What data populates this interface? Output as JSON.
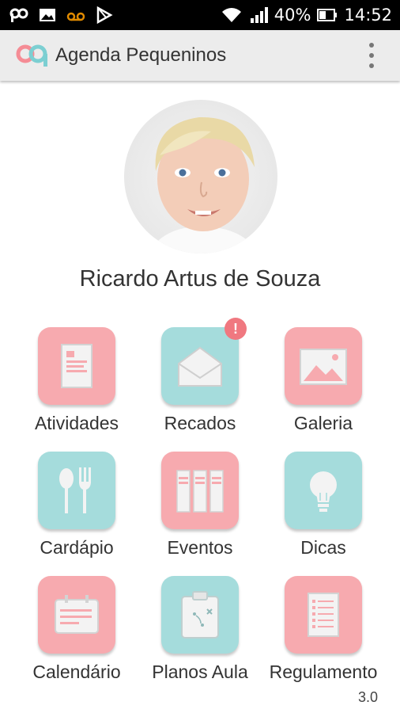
{
  "status_bar": {
    "battery_percent": "40%",
    "time": "14:52"
  },
  "app_bar": {
    "title": "Agenda Pequeninos"
  },
  "profile": {
    "name": "Ricardo Artus de Souza"
  },
  "menu": [
    {
      "label": "Atividades",
      "icon": "document-icon",
      "color": "#f7aaaf"
    },
    {
      "label": "Recados",
      "icon": "envelope-icon",
      "color": "#a5dcdc",
      "badge": "!"
    },
    {
      "label": "Galeria",
      "icon": "image-icon",
      "color": "#f7aaaf"
    },
    {
      "label": "Cardápio",
      "icon": "cutlery-icon",
      "color": "#a5dcdc"
    },
    {
      "label": "Eventos",
      "icon": "calendar-pages-icon",
      "color": "#f7aaaf"
    },
    {
      "label": "Dicas",
      "icon": "lightbulb-icon",
      "color": "#a5dcdc"
    },
    {
      "label": "Calendário",
      "icon": "calendar-icon",
      "color": "#f7aaaf"
    },
    {
      "label": "Planos Aula",
      "icon": "clipboard-icon",
      "color": "#a5dcdc"
    },
    {
      "label": "Regulamento",
      "icon": "list-document-icon",
      "color": "#f7aaaf"
    }
  ],
  "version": "3.0",
  "colors": {
    "pink": "#f7aaaf",
    "teal": "#a5dcdc",
    "badge": "#f07880"
  }
}
